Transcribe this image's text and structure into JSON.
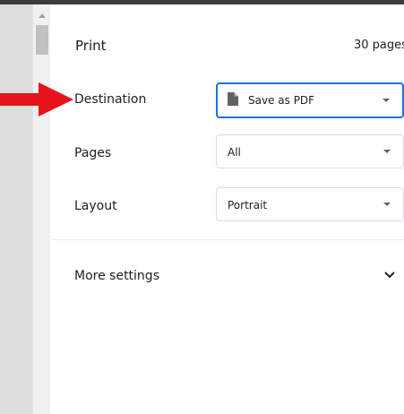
{
  "print": {
    "title": "Print",
    "page_count": "30 pages"
  },
  "destination": {
    "label": "Destination",
    "value": "Save as PDF"
  },
  "pages": {
    "label": "Pages",
    "value": "All"
  },
  "layout": {
    "label": "Layout",
    "value": "Portrait"
  },
  "more_settings": {
    "label": "More settings"
  },
  "colors": {
    "focus_border": "#1a73e8",
    "annotation_arrow": "#e8141b"
  }
}
